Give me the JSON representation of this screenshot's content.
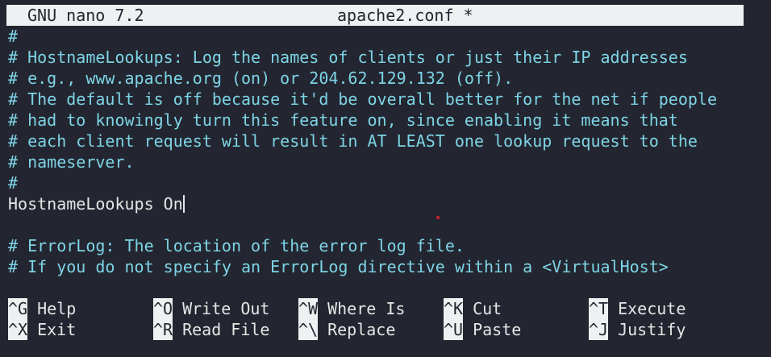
{
  "titlebar": {
    "app_name": "GNU nano 7.2",
    "file_name": "apache2.conf *"
  },
  "editor": {
    "lines": [
      "#",
      "# HostnameLookups: Log the names of clients or just their IP addresses",
      "# e.g., www.apache.org (on) or 204.62.129.132 (off).",
      "# The default is off because it'd be overall better for the net if people",
      "# had to knowingly turn this feature on, since enabling it means that",
      "# each client request will result in AT LEAST one lookup request to the",
      "# nameserver.",
      "#",
      "HostnameLookups On",
      "",
      "# ErrorLog: The location of the error log file.",
      "# If you do not specify an ErrorLog directive within a <VirtualHost>"
    ]
  },
  "shortcuts": [
    {
      "key": "^G",
      "label": "Help"
    },
    {
      "key": "^O",
      "label": "Write Out"
    },
    {
      "key": "^W",
      "label": "Where Is"
    },
    {
      "key": "^K",
      "label": "Cut"
    },
    {
      "key": "^T",
      "label": "Execute"
    },
    {
      "key": "^X",
      "label": "Exit"
    },
    {
      "key": "^R",
      "label": "Read File"
    },
    {
      "key": "^\\",
      "label": "Replace"
    },
    {
      "key": "^U",
      "label": "Paste"
    },
    {
      "key": "^J",
      "label": "Justify"
    }
  ],
  "colors": {
    "background": "#232630",
    "comment": "#7ed4e6",
    "text": "#e6e6e6",
    "bar": "#eef0f2"
  }
}
